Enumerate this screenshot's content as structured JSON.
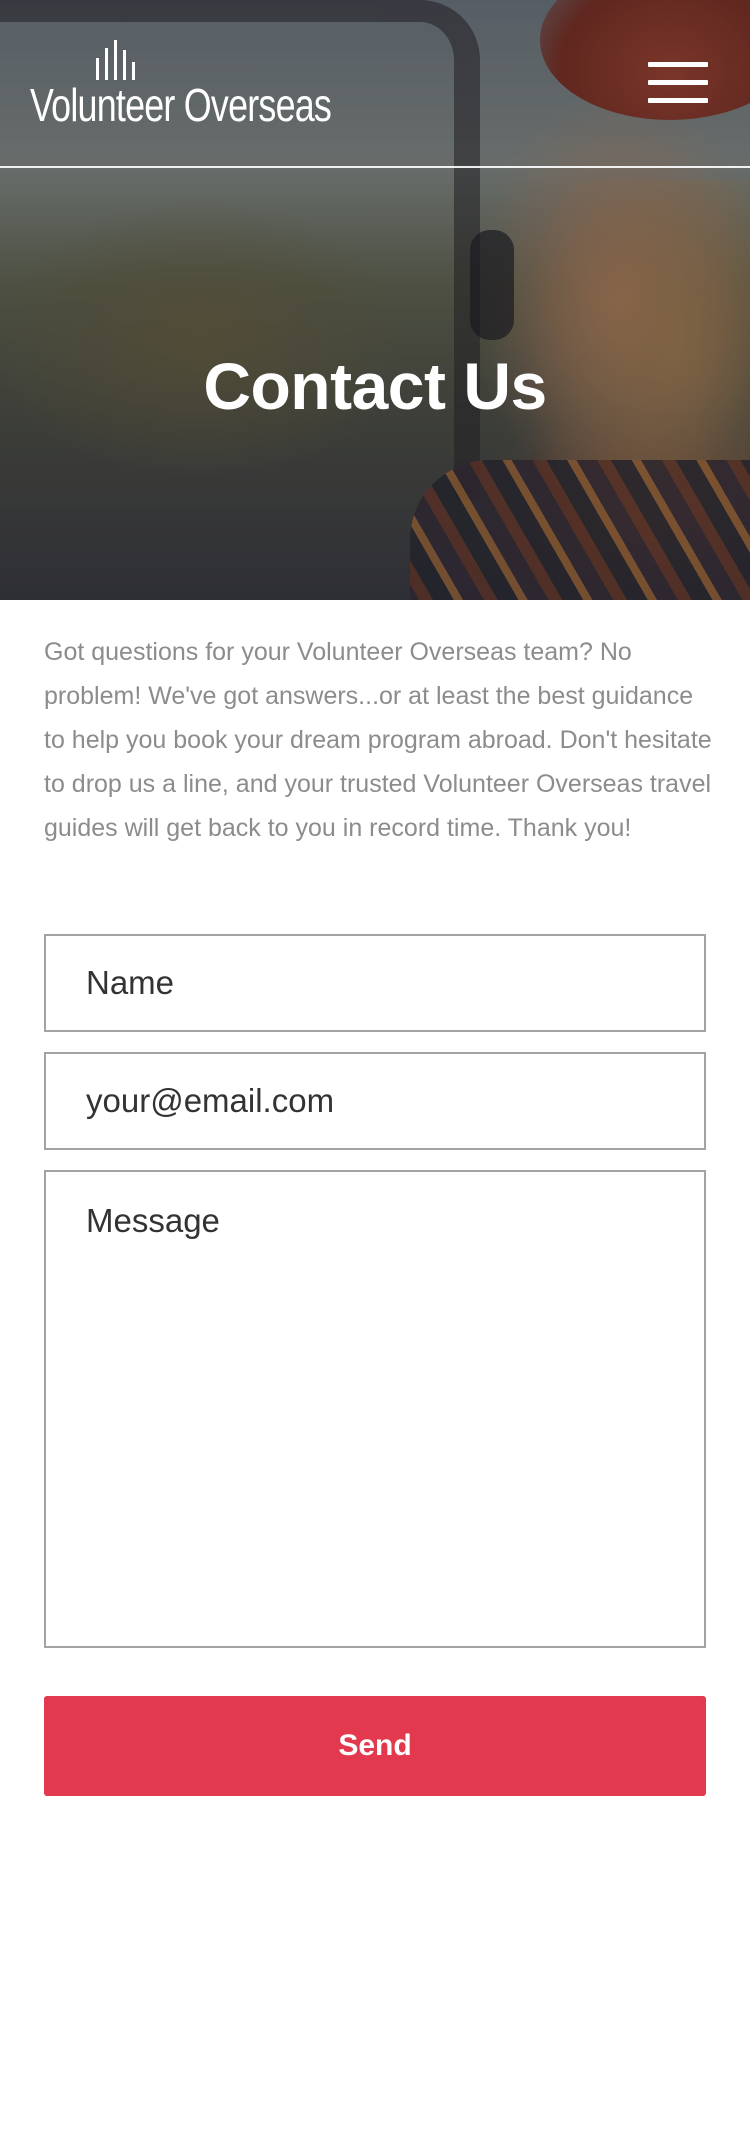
{
  "header": {
    "logo_text": "Volunteer Overseas",
    "menu_icon": "hamburger-menu-icon"
  },
  "hero": {
    "title": "Contact Us"
  },
  "intro": {
    "text": "Got questions for your Volunteer Overseas team? No problem! We've got answers...or at least the best guidance to help you book your dream program abroad. Don't hesitate to drop us a line, and your trusted Volunteer Overseas travel guides will get back to you in record time. Thank you!"
  },
  "form": {
    "name_placeholder": "Name",
    "email_placeholder": "your@email.com",
    "message_placeholder": "Message",
    "send_label": "Send"
  },
  "colors": {
    "accent": "#e3394f",
    "body_text": "#8c8c8c",
    "field_border": "#a3a3a3"
  }
}
